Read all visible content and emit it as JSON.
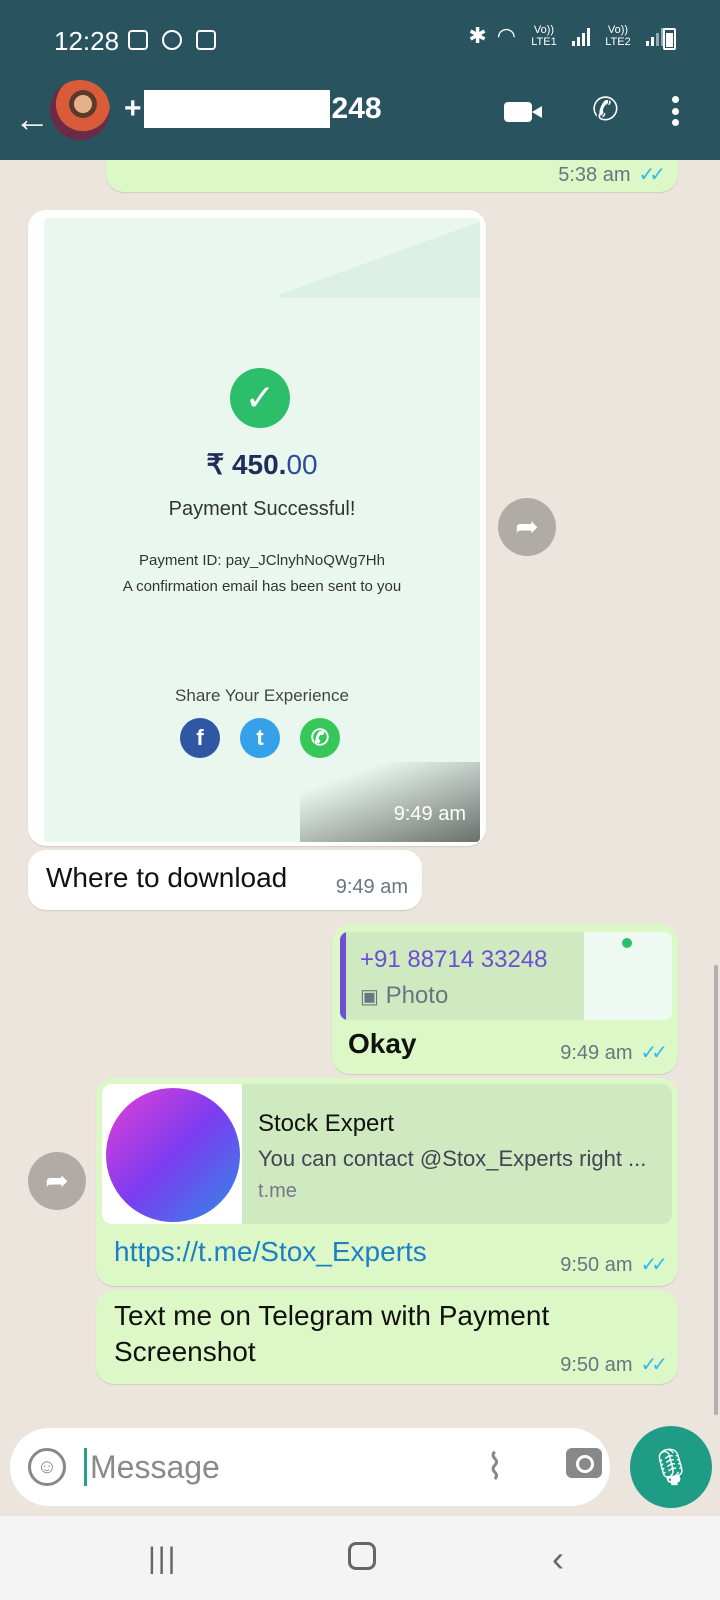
{
  "status_bar": {
    "time": "12:28",
    "sim1": "Vo)) LTE1",
    "sim2": "Vo)) LTE2"
  },
  "header": {
    "contact_prefix": "+",
    "contact_suffix": "248",
    "back_icon": "arrow-left-icon",
    "video_icon": "video-call-icon",
    "call_icon": "phone-icon",
    "menu_icon": "more-vert-icon"
  },
  "messages": [
    {
      "type": "outgoing-text-tail",
      "time": "5:38 am",
      "status": "read"
    },
    {
      "type": "incoming-image",
      "time": "9:49 am",
      "image": {
        "amount_main": "₹ 450.",
        "amount_decimals": "00",
        "status": "Payment Successful!",
        "payment_id": "Payment ID: pay_JClnyhNoQWg7Hh",
        "confirmation": "A confirmation email has been sent to you",
        "share_title": "Share Your Experience",
        "socials": [
          "facebook-icon",
          "twitter-icon",
          "whatsapp-icon"
        ]
      }
    },
    {
      "type": "incoming-text",
      "text": "Where to download",
      "time": "9:49 am"
    },
    {
      "type": "outgoing-reply",
      "quote_name": "+91 88714 33248",
      "quote_kind": "Photo",
      "text": "Okay",
      "time": "9:49 am",
      "status": "read"
    },
    {
      "type": "outgoing-link",
      "link_title": "Stock Expert",
      "link_desc": "You can contact @Stox_Experts right ...",
      "link_domain": "t.me",
      "url": "https://t.me/Stox_Experts",
      "time": "9:50 am",
      "status": "read"
    },
    {
      "type": "outgoing-text",
      "text_line1": "Text me on Telegram with Payment",
      "text_line2": "Screenshot",
      "time": "9:50 am",
      "status": "read"
    }
  ],
  "input": {
    "placeholder": "Message"
  },
  "colors": {
    "header": "#29545f",
    "outgoing_bubble": "#dcf8c6",
    "incoming_bubble": "#ffffff",
    "mic_button": "#1f9c85",
    "read_ticks": "#34b7f1"
  }
}
